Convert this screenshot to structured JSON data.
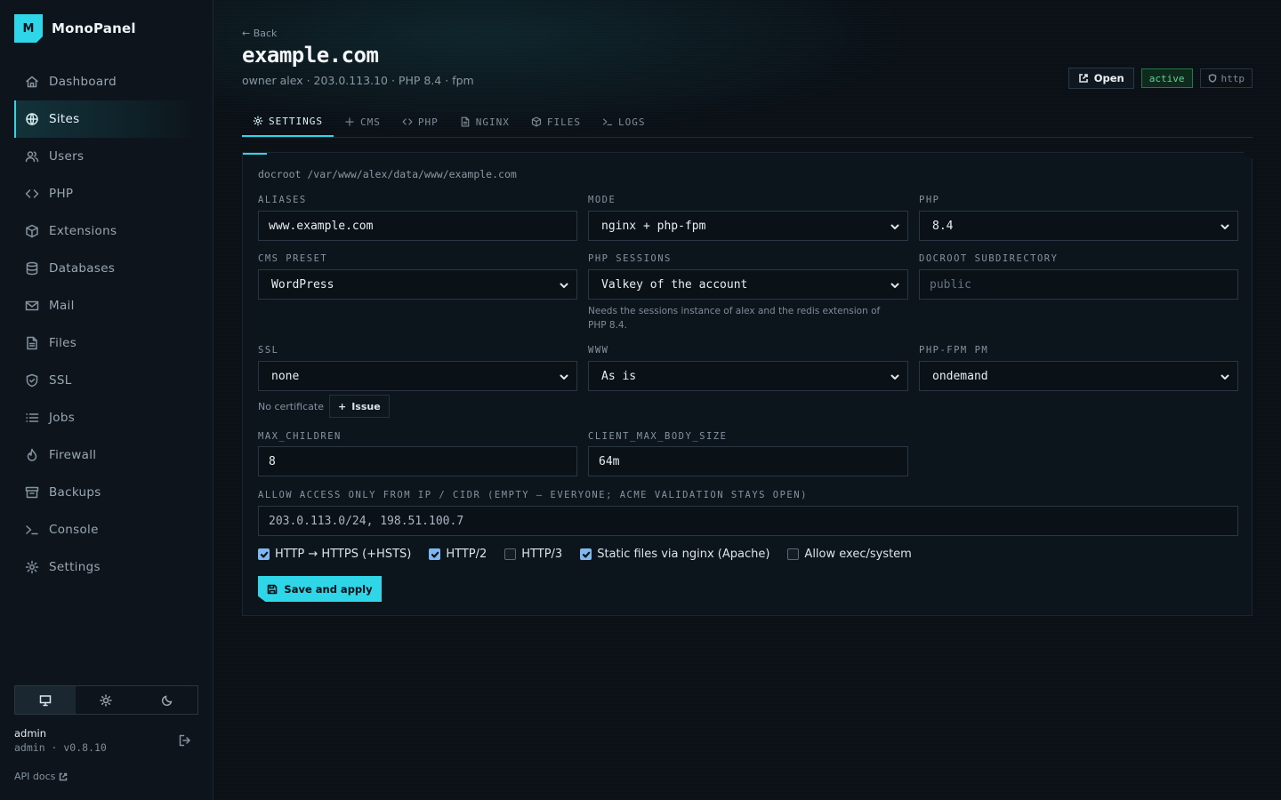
{
  "brand": {
    "logo_letter": "M",
    "name": "MonoPanel"
  },
  "sidebar": {
    "items": [
      {
        "label": "Dashboard",
        "icon": "home-icon"
      },
      {
        "label": "Sites",
        "icon": "globe-icon",
        "active": true
      },
      {
        "label": "Users",
        "icon": "users-icon"
      },
      {
        "label": "PHP",
        "icon": "code-icon"
      },
      {
        "label": "Extensions",
        "icon": "package-icon"
      },
      {
        "label": "Databases",
        "icon": "database-icon"
      },
      {
        "label": "Mail",
        "icon": "mail-icon"
      },
      {
        "label": "Files",
        "icon": "file-icon"
      },
      {
        "label": "SSL",
        "icon": "shield-icon"
      },
      {
        "label": "Jobs",
        "icon": "list-icon"
      },
      {
        "label": "Firewall",
        "icon": "flame-icon"
      },
      {
        "label": "Backups",
        "icon": "archive-icon"
      },
      {
        "label": "Console",
        "icon": "terminal-icon"
      },
      {
        "label": "Settings",
        "icon": "gear-icon"
      }
    ],
    "theme": {
      "options": [
        "monitor-icon",
        "sun-icon",
        "moon-icon"
      ],
      "selected": "monitor-icon"
    },
    "user": {
      "name": "admin",
      "meta": "admin · v0.8.10"
    },
    "api_docs": "API docs"
  },
  "header": {
    "back": "← Back",
    "title": "example.com",
    "subtitle": "owner alex · 203.0.113.10 · PHP 8.4 · fpm",
    "open_label": "Open",
    "status_badge": "active",
    "protocol_badge": "http"
  },
  "tabs": [
    {
      "label": "SETTINGS",
      "icon": "gear-icon",
      "active": true
    },
    {
      "label": "CMS",
      "icon": "plus-icon"
    },
    {
      "label": "PHP",
      "icon": "code-icon"
    },
    {
      "label": "NGINX",
      "icon": "file-icon"
    },
    {
      "label": "FILES",
      "icon": "package-icon"
    },
    {
      "label": "LOGS",
      "icon": "terminal-icon"
    }
  ],
  "form": {
    "docroot": "docroot /var/www/alex/data/www/example.com",
    "aliases": {
      "label": "ALIASES",
      "value": "www.example.com"
    },
    "mode": {
      "label": "MODE",
      "value": "nginx + php-fpm"
    },
    "php": {
      "label": "PHP",
      "value": "8.4"
    },
    "cms_preset": {
      "label": "CMS PRESET",
      "value": "WordPress"
    },
    "php_sessions": {
      "label": "PHP SESSIONS",
      "value": "Valkey of the account",
      "hint_line1": "Needs the sessions instance of alex and the redis extension of",
      "hint_line2": "PHP 8.4."
    },
    "docroot_subdir": {
      "label": "DOCROOT SUBDIRECTORY",
      "placeholder": "public"
    },
    "ssl": {
      "label": "SSL",
      "value": "none",
      "no_cert": "No certificate",
      "issue_label": "Issue"
    },
    "www": {
      "label": "WWW",
      "value": "As is"
    },
    "fpm_pm": {
      "label": "PHP-FPM PM",
      "value": "ondemand"
    },
    "max_children": {
      "label": "MAX_CHILDREN",
      "value": "8"
    },
    "client_max_body_size": {
      "label": "CLIENT_MAX_BODY_SIZE",
      "value": "64m"
    },
    "allow_ip": {
      "label": "ALLOW ACCESS ONLY FROM IP / CIDR (EMPTY — EVERYONE; ACME VALIDATION STAYS OPEN)",
      "value": "203.0.113.0/24, 198.51.100.7"
    },
    "checkboxes": [
      {
        "label": "HTTP → HTTPS (+HSTS)",
        "checked": true
      },
      {
        "label": "HTTP/2",
        "checked": true
      },
      {
        "label": "HTTP/3",
        "checked": false
      },
      {
        "label": "Static files via nginx (Apache)",
        "checked": true
      },
      {
        "label": "Allow exec/system",
        "checked": false
      }
    ],
    "save_label": "Save and apply"
  }
}
